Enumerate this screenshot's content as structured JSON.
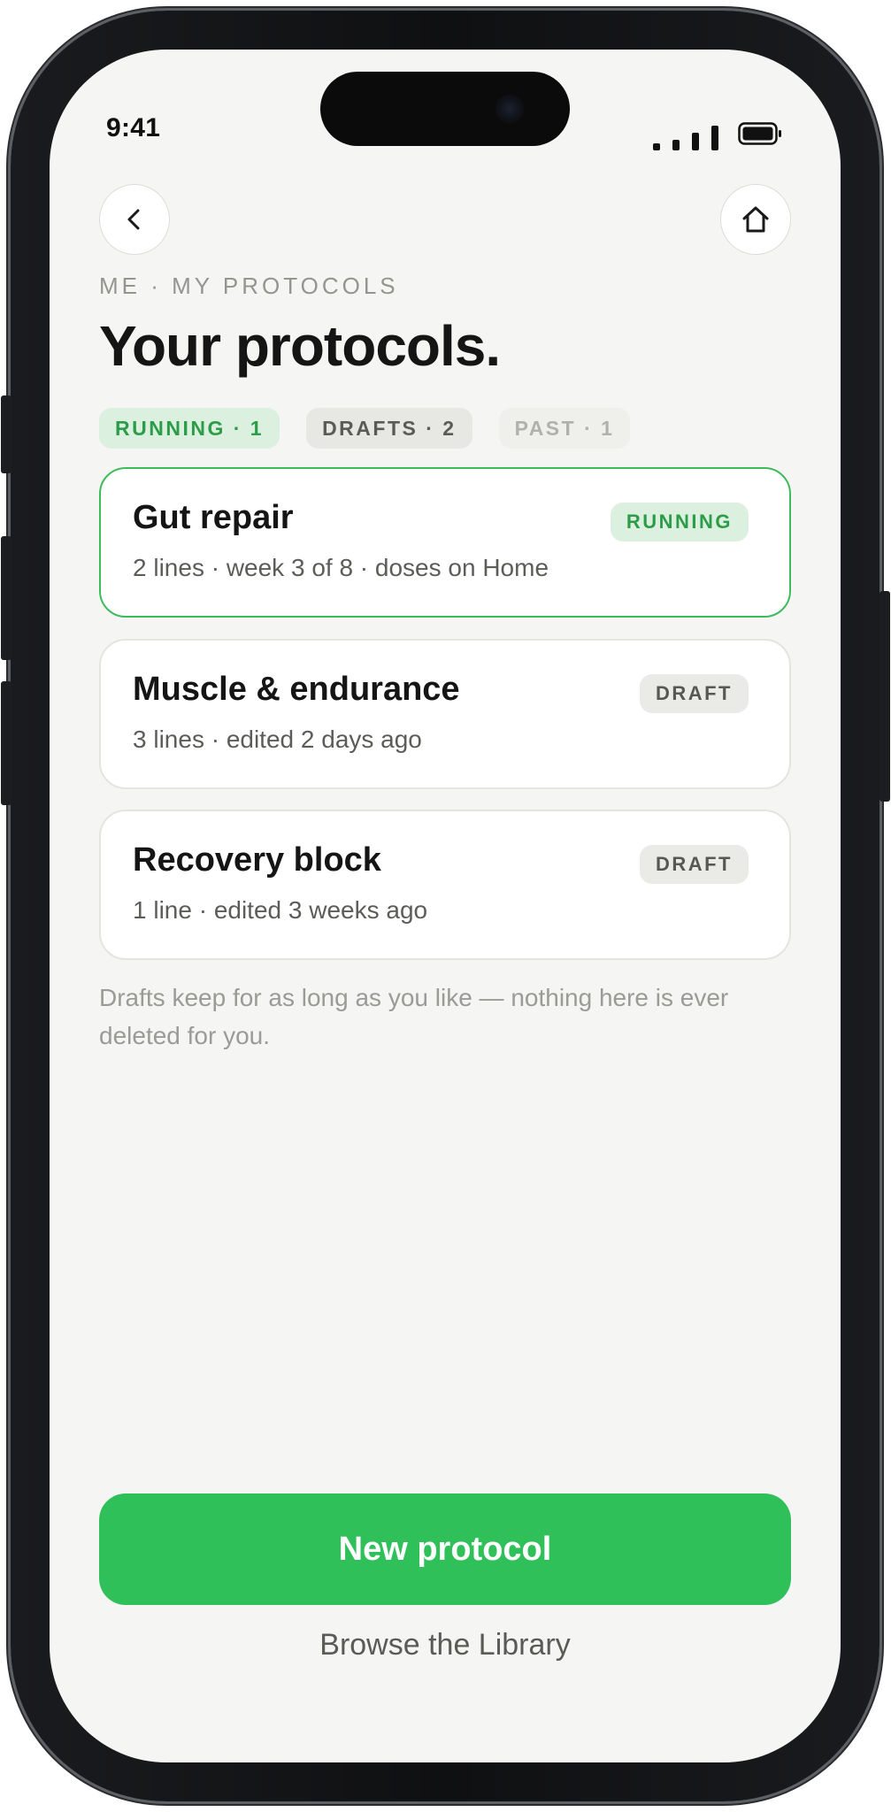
{
  "status_bar": {
    "time": "9:41"
  },
  "nav": {
    "back_icon": "chevron-left-icon",
    "home_icon": "home-icon"
  },
  "breadcrumb": "ME · MY PROTOCOLS",
  "page_title": "Your protocols.",
  "tabs": [
    {
      "label": "RUNNING · 1"
    },
    {
      "label": "DRAFTS · 2"
    },
    {
      "label": "PAST · 1"
    }
  ],
  "protocols": [
    {
      "title": "Gut repair",
      "meta": "2 lines · week 3 of 8 · doses on Home",
      "status": "RUNNING"
    },
    {
      "title": "Muscle & endurance",
      "meta": "3 lines · edited 2 days ago",
      "status": "DRAFT"
    },
    {
      "title": "Recovery block",
      "meta": "1 line · edited 3 weeks ago",
      "status": "DRAFT"
    }
  ],
  "note": "Drafts keep for as long as you like — nothing here is ever deleted for you.",
  "actions": {
    "primary": "New protocol",
    "secondary": "Browse the Library"
  },
  "colors": {
    "accent": "#30c05a",
    "running_badge_text": "#2c9c48",
    "background": "#f5f5f3"
  }
}
